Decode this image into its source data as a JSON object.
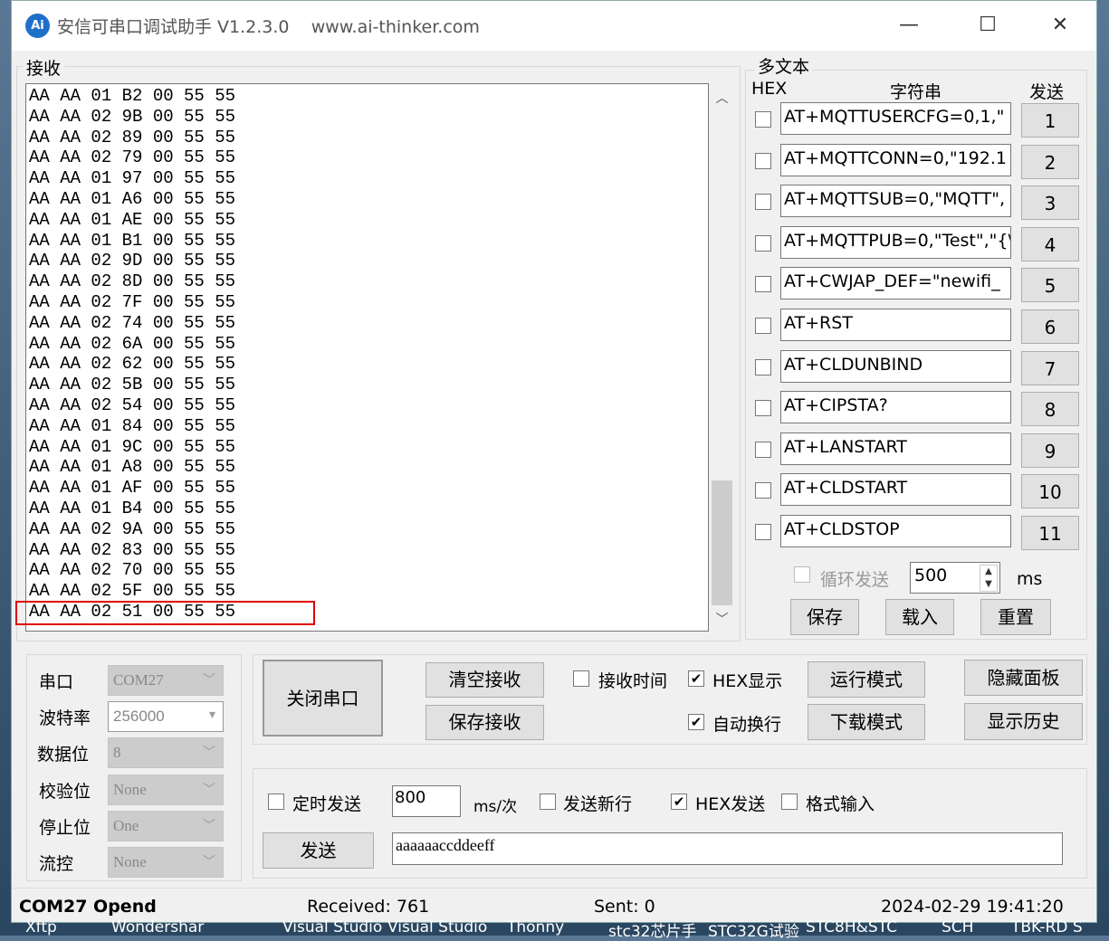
{
  "window": {
    "title": "安信可串口调试助手 V1.2.3.0",
    "url": "www.ai-thinker.com",
    "logo": "Ai",
    "minimize": "—",
    "maximize": "☐",
    "close": "✕"
  },
  "receive": {
    "label": "接收",
    "lines": [
      "AA AA 01 B2 00 55 55",
      "AA AA 02 9B 00 55 55",
      "AA AA 02 89 00 55 55",
      "AA AA 02 79 00 55 55",
      "AA AA 01 97 00 55 55",
      "AA AA 01 A6 00 55 55",
      "AA AA 01 AE 00 55 55",
      "AA AA 01 B1 00 55 55",
      "AA AA 02 9D 00 55 55",
      "AA AA 02 8D 00 55 55",
      "AA AA 02 7F 00 55 55",
      "AA AA 02 74 00 55 55",
      "AA AA 02 6A 00 55 55",
      "AA AA 02 62 00 55 55",
      "AA AA 02 5B 00 55 55",
      "AA AA 02 54 00 55 55",
      "AA AA 01 84 00 55 55",
      "AA AA 01 9C 00 55 55",
      "AA AA 01 A8 00 55 55",
      "AA AA 01 AF 00 55 55",
      "AA AA 01 B4 00 55 55",
      "AA AA 02 9A 00 55 55",
      "AA AA 02 83 00 55 55",
      "AA AA 02 70 00 55 55",
      "AA AA 02 5F 00 55 55",
      "AA AA 02 51 00 55 55"
    ],
    "highlight_color": "#e00000"
  },
  "multi": {
    "label": "多文本",
    "hex_header": "HEX",
    "string_header": "字符串",
    "send_header": "发送",
    "rows": [
      {
        "text": "AT+MQTTUSERCFG=0,1,\"",
        "btn": "1"
      },
      {
        "text": "AT+MQTTCONN=0,\"192.1",
        "btn": "2"
      },
      {
        "text": "AT+MQTTSUB=0,\"MQTT\",",
        "btn": "3"
      },
      {
        "text": "AT+MQTTPUB=0,\"Test\",\"{\\",
        "btn": "4"
      },
      {
        "text": "AT+CWJAP_DEF=\"newifi_",
        "btn": "5"
      },
      {
        "text": "AT+RST",
        "btn": "6"
      },
      {
        "text": "AT+CLDUNBIND",
        "btn": "7"
      },
      {
        "text": "AT+CIPSTA?",
        "btn": "8"
      },
      {
        "text": "AT+LANSTART",
        "btn": "9"
      },
      {
        "text": "AT+CLDSTART",
        "btn": "10"
      },
      {
        "text": "AT+CLDSTOP",
        "btn": "11"
      }
    ],
    "loop_label": "循环发送",
    "loop_ms": "500",
    "ms": "ms",
    "save": "保存",
    "load": "载入",
    "reset": "重置"
  },
  "port": {
    "labels": [
      "串口",
      "波特率",
      "数据位",
      "校验位",
      "停止位",
      "流控"
    ],
    "values": [
      "COM27",
      "256000",
      "8",
      "None",
      "One",
      "None"
    ]
  },
  "controls": {
    "close_port": "关闭串口",
    "clear_rx": "清空接收",
    "save_rx": "保存接收",
    "rx_time": "接收时间",
    "rx_time_checked": false,
    "hex_display": "HEX显示",
    "hex_display_checked": true,
    "auto_wrap": "自动换行",
    "auto_wrap_checked": true,
    "run_mode": "运行模式",
    "download_mode": "下载模式",
    "hide_panel": "隐藏面板",
    "show_history": "显示历史"
  },
  "send": {
    "timed": "定时发送",
    "timed_checked": false,
    "interval": "800",
    "unit": "ms/次",
    "newline": "发送新行",
    "newline_checked": false,
    "hex_send": "HEX发送",
    "hex_send_checked": true,
    "format_input": "格式输入",
    "format_input_checked": false,
    "send_btn": "发送",
    "value": "aaaaaaccddeeff"
  },
  "statusbar": {
    "port": "COM27 Opend",
    "received": "Received: 761",
    "sent": "Sent: 0",
    "datetime": "2024-02-29 19:41:20"
  },
  "taskbar": [
    "Xftp",
    "Wondershar",
    "Visual Studio",
    "Visual Studio",
    "Thonny",
    "stc32芯片手",
    "STC32G试验",
    "STC8H&STC",
    "SCH",
    "TBK-RD S"
  ]
}
